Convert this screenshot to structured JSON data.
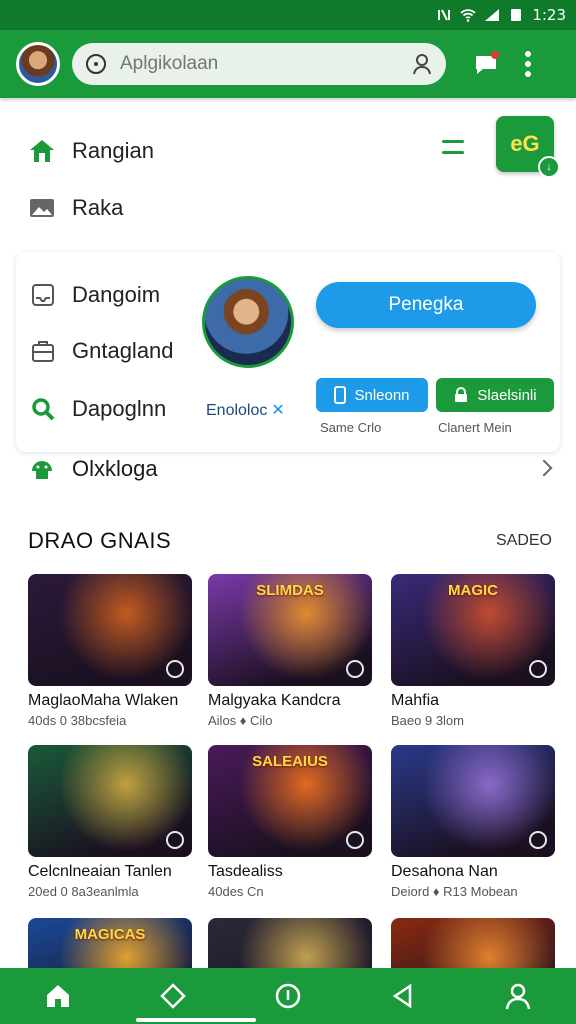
{
  "status": {
    "time": "1:23"
  },
  "search": {
    "placeholder": "Aplgikolaan"
  },
  "menu": {
    "items": [
      {
        "label": "Rangian",
        "icon": "home-icon"
      },
      {
        "label": "Raka",
        "icon": "image-icon"
      }
    ],
    "badge_text": "eG"
  },
  "panel": {
    "items": [
      {
        "label": "Dangoim",
        "icon": "inbox-icon"
      },
      {
        "label": "Gntagland",
        "icon": "briefcase-icon"
      },
      {
        "label": "Dapoglnn",
        "icon": "search-icon"
      }
    ],
    "enroll_label": "Enololoc",
    "primary_button": "Penegka",
    "blue_button": "Snleonn",
    "green_button": "Slaelsinli",
    "blue_caption": "Same Crlo",
    "green_caption": "Clanert Mein"
  },
  "more_row": {
    "label": "Olxkloga",
    "icon": "android-icon"
  },
  "section": {
    "title": "DRAO GNAIS",
    "link": "SADEO"
  },
  "games": [
    {
      "title": "MaglaoMaha Wlaken",
      "meta": "40ds 0 38bcsfeia",
      "logo": "",
      "colors": [
        "#2b1a3a",
        "#c35a20"
      ]
    },
    {
      "title": "Malgyaka Kandcra",
      "meta": "Ailos ♦ Cilo",
      "logo": "SLIMDAS",
      "colors": [
        "#7a3aa8",
        "#e08a30"
      ]
    },
    {
      "title": "Mahfia",
      "meta": "Baeo 9 3lom",
      "logo": "MAGIC",
      "colors": [
        "#3a2a7a",
        "#c04a30"
      ]
    },
    {
      "title": "Celcnlneaian Tanlen",
      "meta": "20ed 0 8a3eanlmla",
      "logo": "",
      "colors": [
        "#1a5a3a",
        "#c0a040"
      ]
    },
    {
      "title": "Tasdealiss",
      "meta": "40des Cn",
      "logo": "SALEAIUS",
      "colors": [
        "#4a1a5a",
        "#e06a20"
      ]
    },
    {
      "title": "Desahona Nan",
      "meta": "Deiord ♦ R13 Mobean",
      "logo": "",
      "colors": [
        "#2a3a8a",
        "#8a6ac8"
      ]
    },
    {
      "title": "",
      "meta": "",
      "logo": "MAGICAS",
      "colors": [
        "#1a4a9a",
        "#e0a030"
      ]
    },
    {
      "title": "",
      "meta": "",
      "logo": "",
      "colors": [
        "#2a2a3a",
        "#c0a050"
      ]
    },
    {
      "title": "",
      "meta": "",
      "logo": "",
      "colors": [
        "#8a2a10",
        "#e08030"
      ]
    }
  ]
}
